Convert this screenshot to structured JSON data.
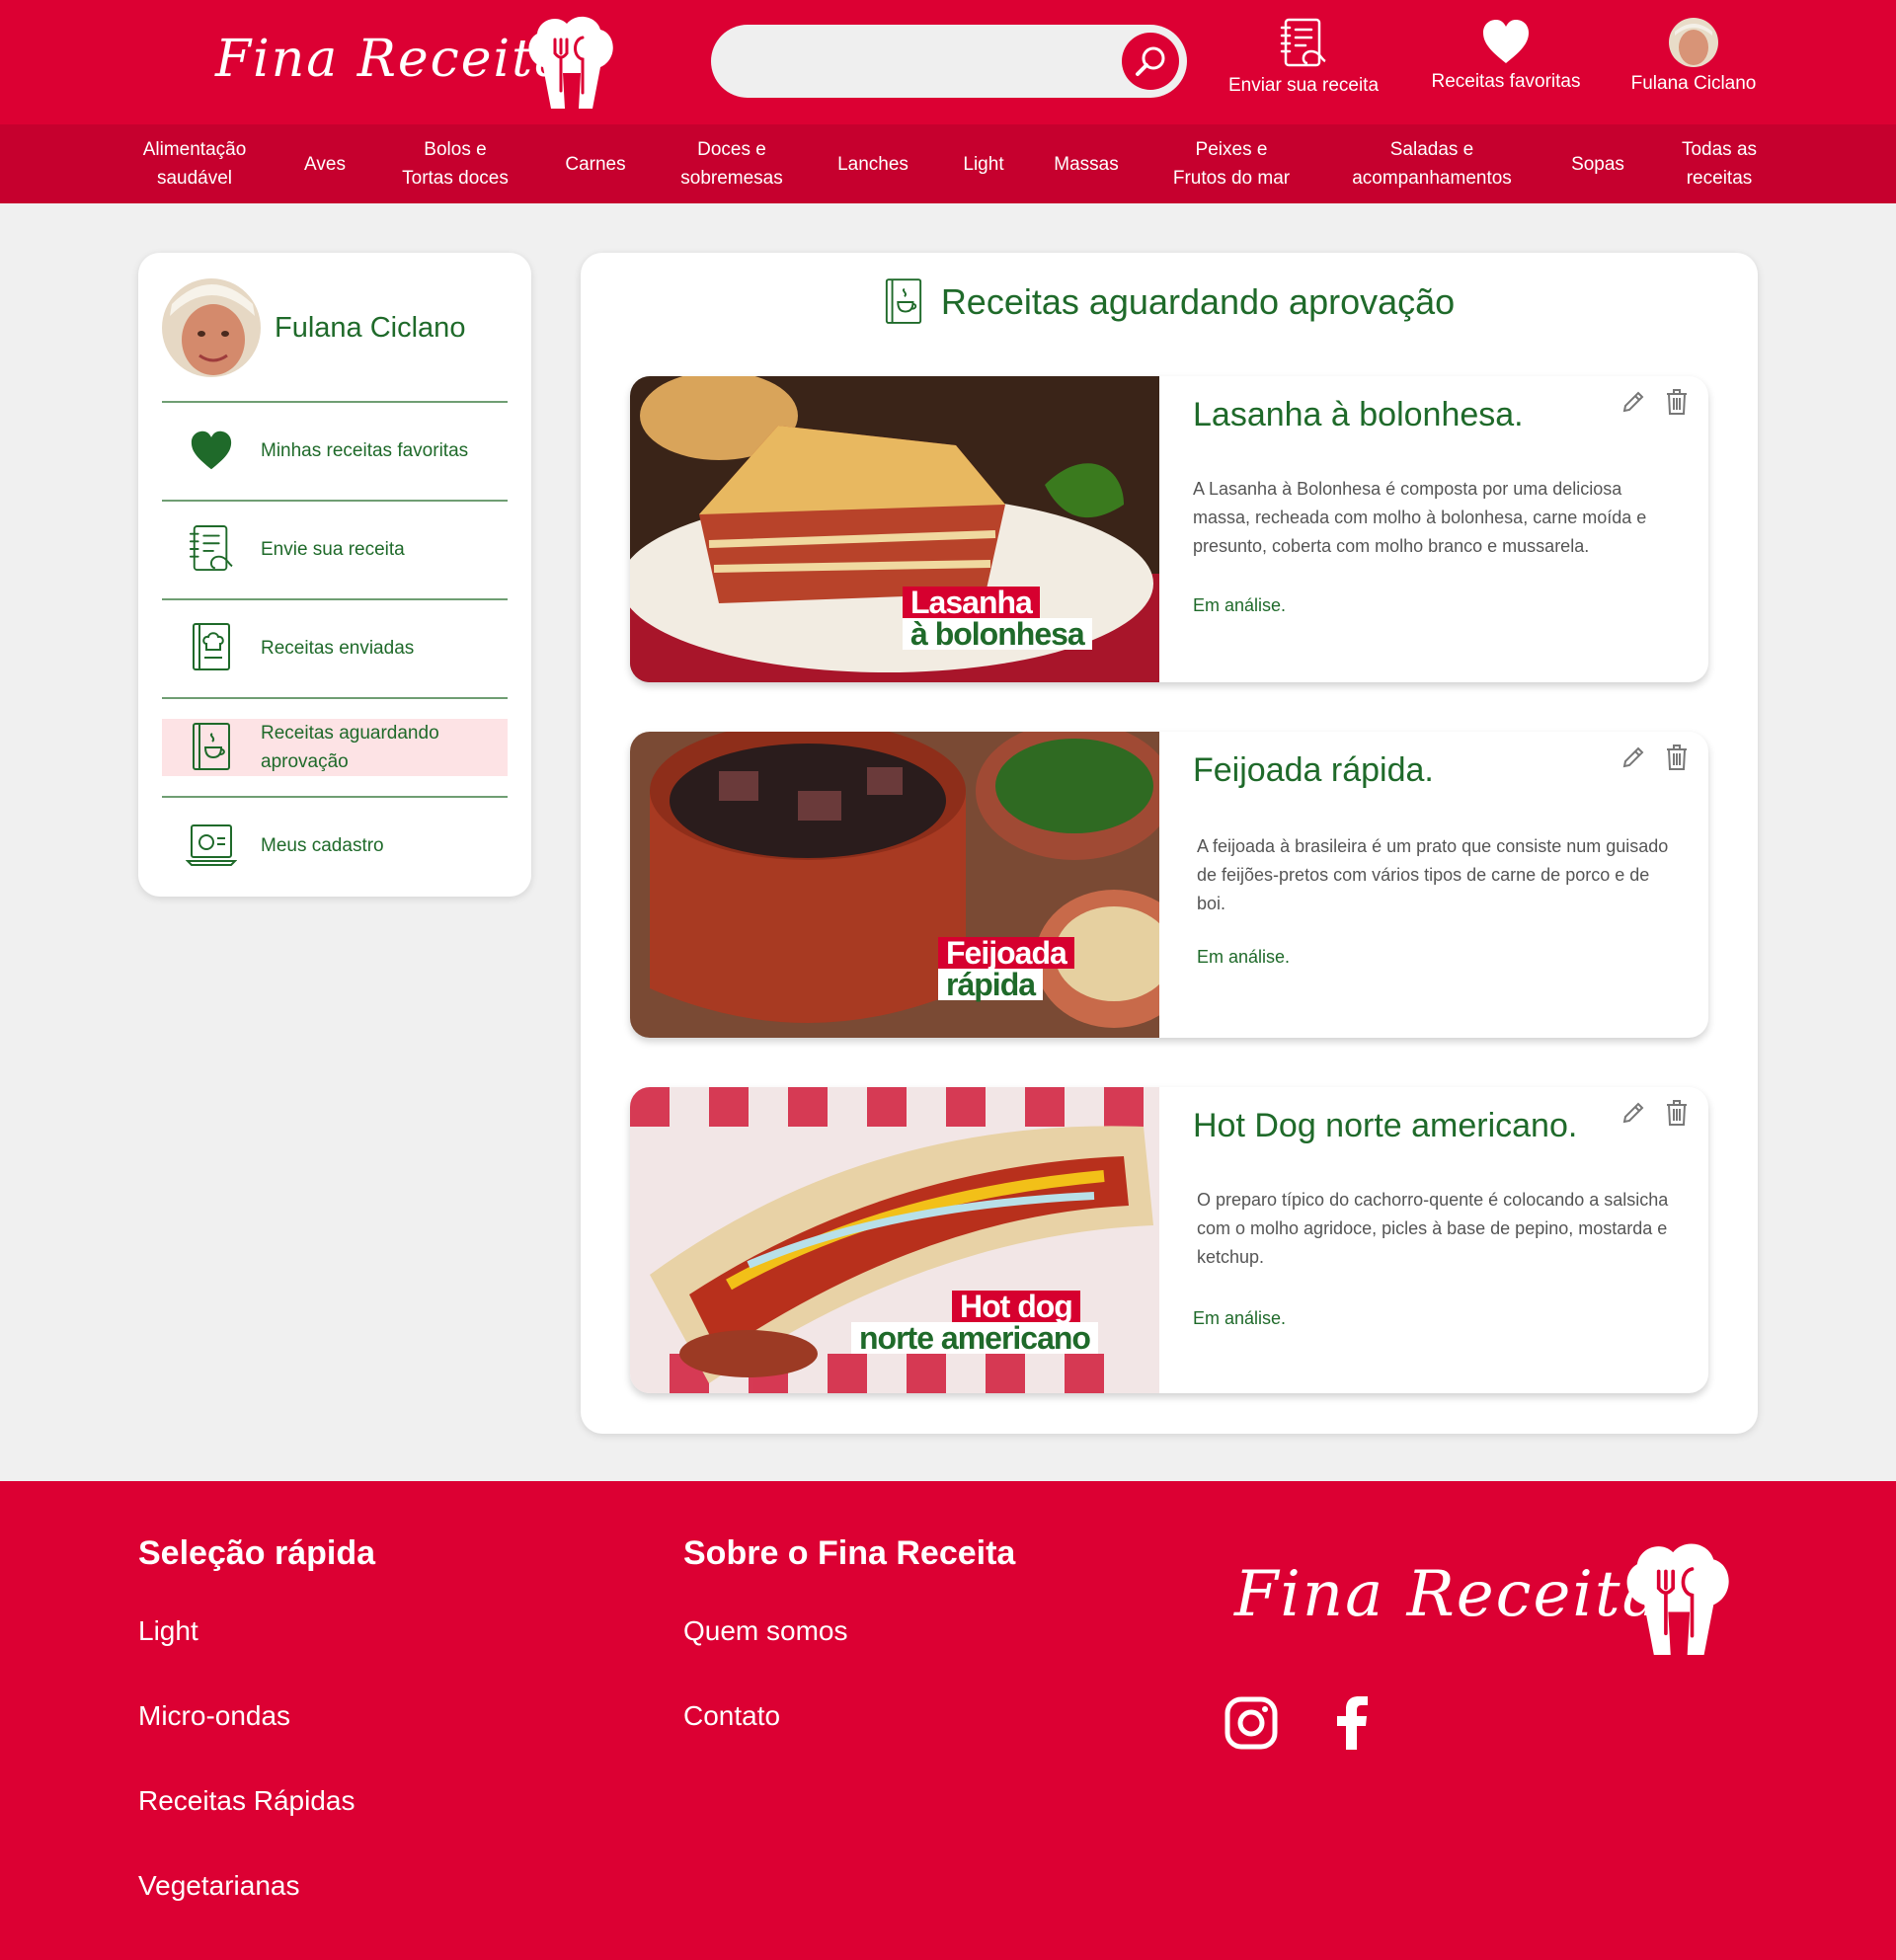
{
  "brand": {
    "name": "Fina Receita",
    "primary_color": "#dc0033",
    "nav_color": "#c6002e",
    "accent_green": "#1f6a2a"
  },
  "header": {
    "search": {
      "placeholder": "",
      "value": ""
    },
    "actions": {
      "submit_recipe": "Enviar sua receita",
      "favorites": "Receitas favoritas",
      "user": "Fulana Ciclano"
    }
  },
  "nav": {
    "items": [
      "Alimentação\nsaudável",
      "Aves",
      "Bolos e\nTortas doces",
      "Carnes",
      "Doces e\nsobremesas",
      "Lanches",
      "Light",
      "Massas",
      "Peixes e\nFrutos do mar",
      "Saladas e\nacompanhamentos",
      "Sopas",
      "Todas as\nreceitas"
    ]
  },
  "sidebar": {
    "user_name": "Fulana Ciclano",
    "items": [
      {
        "label": "Minhas receitas favoritas",
        "icon": "heart-icon"
      },
      {
        "label": "Envie sua receita",
        "icon": "notepad-icon"
      },
      {
        "label": "Receitas enviadas",
        "icon": "recipe-book-icon"
      },
      {
        "label": "Receitas aguardando aprovação",
        "icon": "pending-book-icon",
        "active": true
      },
      {
        "label": "Meus cadastro",
        "icon": "profile-card-icon"
      }
    ]
  },
  "main": {
    "title": "Receitas aguardando aprovação",
    "cards": [
      {
        "title": "Lasanha à bolonhesa.",
        "image_line1": "Lasanha",
        "image_line2": "à bolonhesa",
        "description": "A Lasanha à Bolonhesa é composta por uma deliciosa massa, recheada com molho à bolonhesa, carne moída e presunto, coberta com molho branco e mussarela.",
        "status": "Em análise."
      },
      {
        "title": "Feijoada rápida.",
        "image_line1": "Feijoada",
        "image_line2": "rápida",
        "description": "A feijoada à brasileira é um prato que consiste num guisado de feijões-pretos com vários tipos de carne de porco e de boi.",
        "status": "Em análise."
      },
      {
        "title": "Hot Dog norte americano.",
        "image_line1": "Hot dog",
        "image_line2": "norte americano",
        "description": "O preparo típico do cachorro-quente é colocando a salsicha com o molho agridoce, picles à base de pepino, mostarda e ketchup.",
        "status": "Em análise."
      }
    ]
  },
  "footer": {
    "quick_title": "Seleção rápida",
    "quick_links": [
      "Light",
      "Micro-ondas",
      "Receitas Rápidas",
      "Vegetarianas"
    ],
    "about_title": "Sobre o Fina Receita",
    "about_links": [
      "Quem somos",
      "Contato"
    ],
    "social": [
      "instagram-icon",
      "facebook-icon"
    ]
  }
}
